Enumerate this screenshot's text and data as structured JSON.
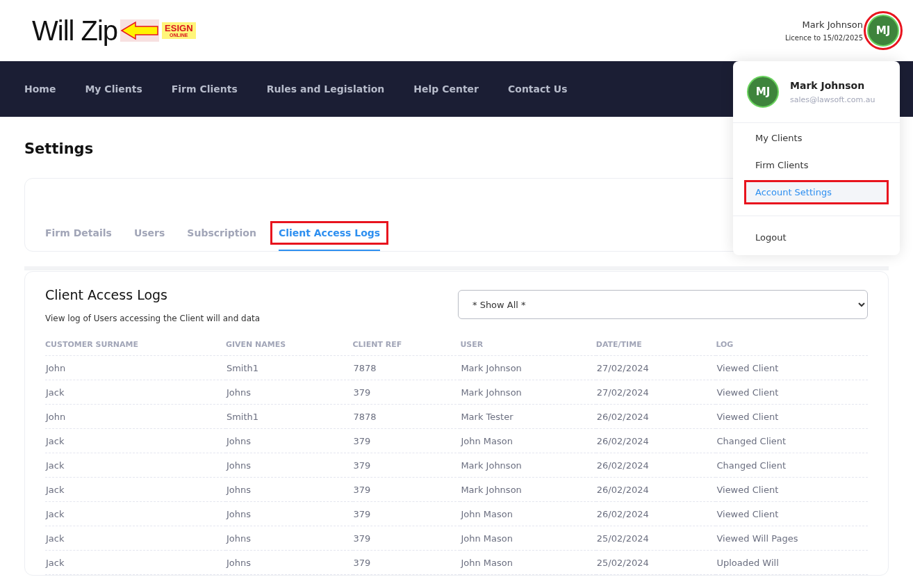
{
  "logo": {
    "name": "Will Zip",
    "badge_top": "ESIGN",
    "badge_bottom": "ONLINE"
  },
  "user": {
    "name": "Mark Johnson",
    "licence": "Licence to 15/02/2025",
    "initials": "MJ",
    "highlighted": true
  },
  "nav": [
    "Home",
    "My Clients",
    "Firm Clients",
    "Rules and Legislation",
    "Help Center",
    "Contact Us"
  ],
  "page_title": "Settings",
  "tabs": [
    {
      "label": "Firm Details",
      "selected": false,
      "highlighted": false
    },
    {
      "label": "Users",
      "selected": false,
      "highlighted": false
    },
    {
      "label": "Subscription",
      "selected": false,
      "highlighted": false
    },
    {
      "label": "Client Access Logs",
      "selected": true,
      "highlighted": true
    }
  ],
  "logs": {
    "title": "Client Access Logs",
    "description": "View log of Users accessing the Client will and data",
    "filter": "* Show All *",
    "columns": [
      "CUSTOMER SURNAME",
      "GIVEN NAMES",
      "CLIENT REF",
      "USER",
      "DATE/TIME",
      "LOG"
    ],
    "rows": [
      [
        "John",
        "Smith1",
        "7878",
        "Mark Johnson",
        "27/02/2024",
        "Viewed Client"
      ],
      [
        "Jack",
        "Johns",
        "379",
        "Mark Johnson",
        "27/02/2024",
        "Viewed Client"
      ],
      [
        "John",
        "Smith1",
        "7878",
        "Mark Tester",
        "26/02/2024",
        "Viewed Client"
      ],
      [
        "Jack",
        "Johns",
        "379",
        "John Mason",
        "26/02/2024",
        "Changed Client"
      ],
      [
        "Jack",
        "Johns",
        "379",
        "Mark Johnson",
        "26/02/2024",
        "Changed Client"
      ],
      [
        "Jack",
        "Johns",
        "379",
        "Mark Johnson",
        "26/02/2024",
        "Viewed Client"
      ],
      [
        "Jack",
        "Johns",
        "379",
        "John Mason",
        "26/02/2024",
        "Viewed Client"
      ],
      [
        "Jack",
        "Johns",
        "379",
        "John Mason",
        "25/02/2024",
        "Viewed Will Pages"
      ],
      [
        "Jack",
        "Johns",
        "379",
        "John Mason",
        "25/02/2024",
        "Uploaded Will"
      ]
    ]
  },
  "menu": {
    "initials": "MJ",
    "name": "Mark Johnson",
    "email": "sales@lawsoft.com.au",
    "items": [
      {
        "label": "My Clients",
        "selected": false,
        "highlighted": false,
        "kind": "link"
      },
      {
        "label": "Firm Clients",
        "selected": false,
        "highlighted": false,
        "kind": "link"
      },
      {
        "label": "Account Settings",
        "selected": true,
        "highlighted": true,
        "kind": "link"
      },
      {
        "label": "Logout",
        "selected": false,
        "highlighted": false,
        "kind": "action"
      }
    ]
  }
}
